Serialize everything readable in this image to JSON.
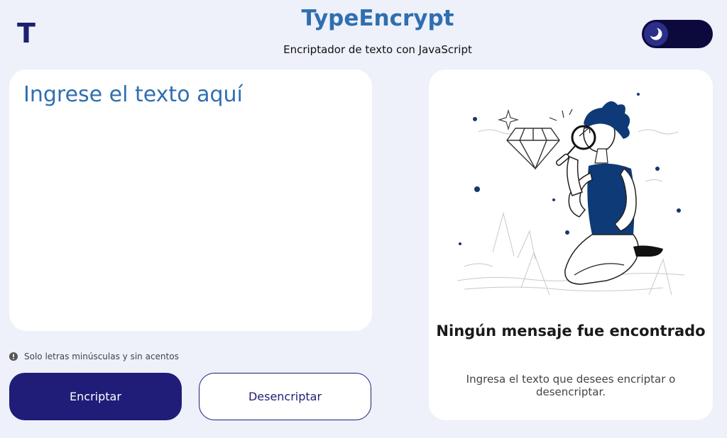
{
  "header": {
    "logo_letter": "T",
    "title": "TypeEncrypt",
    "subtitle": "Encriptador de texto con JavaScript",
    "theme_toggle_icon": "moon-icon"
  },
  "input": {
    "placeholder": "Ingrese el texto aquí",
    "value": ""
  },
  "hint": {
    "icon": "info-icon",
    "text": "Solo letras minúsculas y sin acentos"
  },
  "buttons": {
    "encrypt_label": "Encriptar",
    "decrypt_label": "Desencriptar"
  },
  "result": {
    "illustration": "person-with-magnifying-glass-diamond",
    "empty_title": "Ningún mensaje fue encontrado",
    "empty_description": "Ingresa el texto que desees encriptar o desencriptar."
  },
  "colors": {
    "background": "#eef0fa",
    "primary": "#1f1d78",
    "accent": "#2f6fb0",
    "toggle_bg": "#0c0a3d"
  }
}
